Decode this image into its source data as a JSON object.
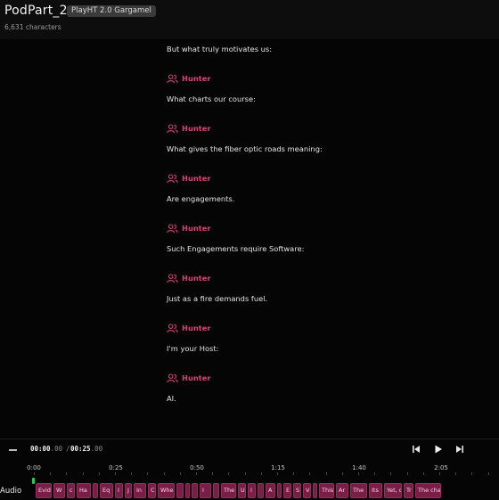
{
  "header": {
    "project_title": "PodPart_2",
    "model_badge": "PlayHT 2.0 Gargamel",
    "char_count": "6,631 characters"
  },
  "colors": {
    "speaker_accent": "#e0407a",
    "clip_fill": "#7a1e48",
    "playhead": "#2fc94a"
  },
  "script": [
    {
      "type": "line",
      "text": "But what truly motivates us:"
    },
    {
      "type": "speaker",
      "name": "Hunter",
      "icon": "users-icon"
    },
    {
      "type": "line",
      "text": "What charts our course:"
    },
    {
      "type": "speaker",
      "name": "Hunter",
      "icon": "users-icon"
    },
    {
      "type": "line",
      "text": "What gives the fiber optic roads meaning:"
    },
    {
      "type": "speaker",
      "name": "Hunter",
      "icon": "users-icon"
    },
    {
      "type": "line",
      "text": "Are engagements."
    },
    {
      "type": "speaker",
      "name": "Hunter",
      "icon": "users-icon"
    },
    {
      "type": "line",
      "text": "Such Engagements require Software:"
    },
    {
      "type": "speaker",
      "name": "Hunter",
      "icon": "users-icon"
    },
    {
      "type": "line",
      "text": "Just as a fire demands fuel."
    },
    {
      "type": "speaker",
      "name": "Hunter",
      "icon": "users-icon"
    },
    {
      "type": "line",
      "text": "I'm your Host:"
    },
    {
      "type": "speaker",
      "name": "Hunter",
      "icon": "users-icon"
    },
    {
      "type": "line",
      "text": "AI."
    }
  ],
  "player": {
    "zoom_out_icon": "minus-icon",
    "time_current_main": "00:00",
    "time_current_ms": ".00",
    "time_separator": "/",
    "time_total_main": "00:25",
    "time_total_ms": ".00",
    "skip_back_icon": "skip-back-icon",
    "play_icon": "play-icon",
    "skip_forward_icon": "skip-forward-icon"
  },
  "timeline": {
    "ruler_labels": [
      "0:00",
      "0:25",
      "0:50",
      "1:15",
      "1:40",
      "2:05"
    ],
    "track_label": "Audio",
    "clips": [
      "Evid",
      "W",
      "c",
      "Ha",
      "",
      "Eq",
      "I",
      "J",
      "In",
      "C",
      "Whe",
      "",
      "",
      "",
      "I",
      "",
      "The",
      "U",
      "I",
      "",
      "A",
      "",
      "E",
      "S",
      "V",
      "",
      "This",
      "Ar",
      "The",
      "Its",
      "Yet, c",
      "Tr",
      "The cha"
    ]
  }
}
